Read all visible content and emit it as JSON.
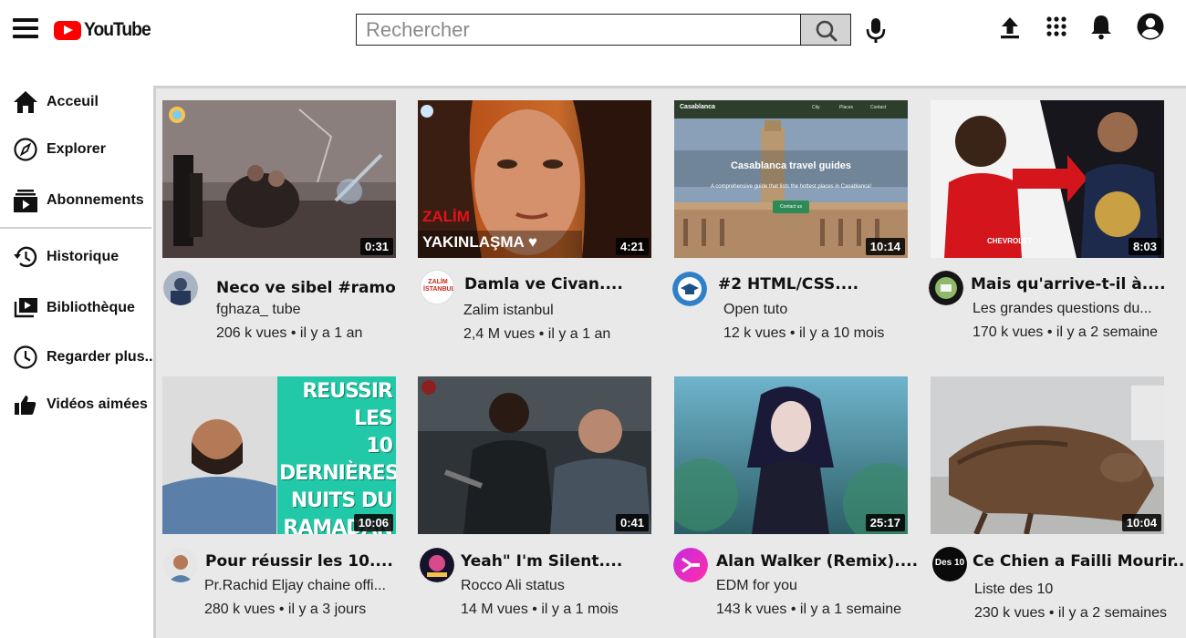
{
  "header": {
    "logo_text": "YouTube",
    "search_placeholder": "Rechercher"
  },
  "sidebar": {
    "items": [
      {
        "label": "Acceuil",
        "icon": "home-icon"
      },
      {
        "label": "Explorer",
        "icon": "compass-icon"
      },
      {
        "label": "Abonnements",
        "icon": "subscriptions-icon"
      },
      {
        "label": "Historique",
        "icon": "history-icon"
      },
      {
        "label": "Bibliothèque",
        "icon": "library-icon"
      },
      {
        "label": "Regarder plus..",
        "icon": "clock-icon"
      },
      {
        "label": "Vidéos aimées",
        "icon": "thumbs-up-icon"
      }
    ]
  },
  "videos": [
    {
      "title": "Neco ve sibel #ramo",
      "channel": "fghaza_ tube",
      "views": "206 k vues",
      "age": "il y a 1 an",
      "duration": "0:31"
    },
    {
      "title": "Damla ve Civan....",
      "channel": "Zalim istanbul",
      "views": "2,4 M vues",
      "age": "il y a 1 an",
      "duration": "4:21",
      "thumb_text_1": "ZALİM",
      "thumb_text_2": "YAKINLAŞMA ♥",
      "avatar_text": "ZALİM İSTANBUL"
    },
    {
      "title": "#2 HTML/CSS....",
      "channel": "Open tuto",
      "views": "12 k vues",
      "age": "il y a 10 mois",
      "duration": "10:14",
      "thumb_text_1": "Casablanca travel guides",
      "thumb_text_2": "A comprehensive guide that lists the hottest places in Casablanca!",
      "thumb_brand": "Casablanca",
      "thumb_nav": [
        "City",
        "Places",
        "Contact"
      ],
      "thumb_button": "Contact us"
    },
    {
      "title": "Mais qu'arrive-t-il à....",
      "channel": "Les grandes questions du...",
      "views": "170 k vues",
      "age": "il y a 2 semaine",
      "duration": "8:03",
      "thumb_text_1": "CHEVROLET"
    },
    {
      "title": "Pour réussir les 10....",
      "channel": "Pr.Rachid Eljay chaine offi...",
      "views": "280 k vues",
      "age": "il y a 3 jours",
      "duration": "10:06",
      "thumb_text_1": "REUSSIR LES",
      "thumb_text_2": "10 DERNIÈRES",
      "thumb_text_3": "NUITS DU",
      "thumb_text_4": "RAMADAN"
    },
    {
      "title": "Yeah\" I'm Silent....",
      "channel": "Rocco Ali status",
      "views": "14 M vues",
      "age": "il y a 1 mois",
      "duration": "0:41"
    },
    {
      "title": "Alan Walker (Remix)....",
      "channel": "EDM for you",
      "views": "143 k vues",
      "age": "il y a 1 semaine",
      "duration": "25:17"
    },
    {
      "title": "Ce Chien a Failli Mourir..",
      "channel": "Liste des 10",
      "views": "230 k vues",
      "age": "il y a 2 semaines",
      "duration": "10:04",
      "avatar_text": "Des 10"
    }
  ],
  "colors": {
    "brand_red": "#ff0000",
    "content_bg": "#e9e9e9",
    "search_button_bg": "#d3d3d3"
  }
}
